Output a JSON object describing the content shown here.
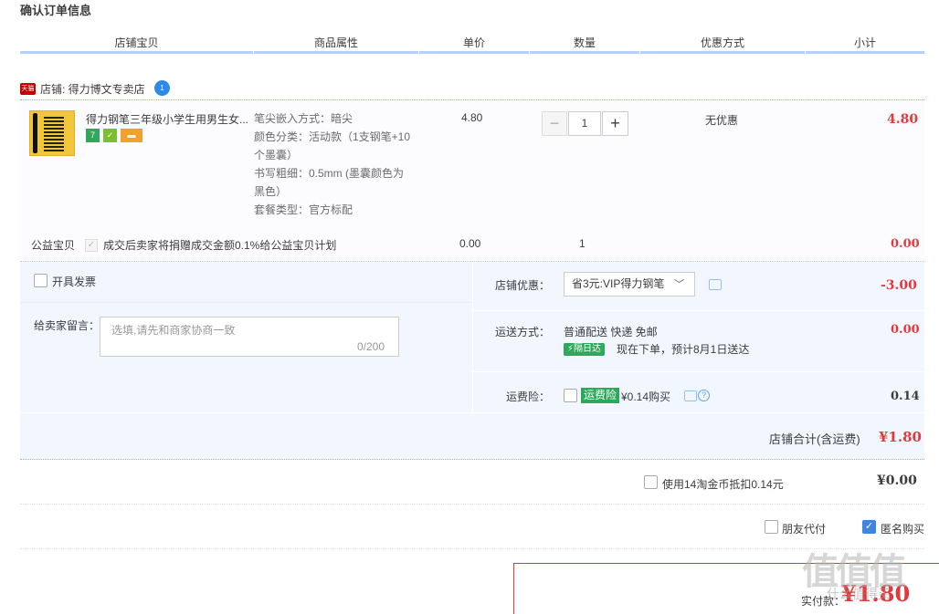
{
  "page": {
    "title": "确认订单信息"
  },
  "columns": [
    "店铺宝贝",
    "商品属性",
    "单价",
    "数量",
    "优惠方式",
    "小计"
  ],
  "shop": {
    "badge": "天猫",
    "label": "店铺: 得力博文专卖店",
    "ww_icon": "1"
  },
  "item": {
    "name": "得力钢笔三年级小学生用男生女...",
    "service_icons": [
      {
        "text": "7",
        "icon": "seven-day-return-icon",
        "color": "#2ea85a"
      },
      {
        "text": "✓",
        "icon": "quality-guarantee-icon",
        "color": "#7cbf2e"
      },
      {
        "text": "▬",
        "icon": "credit-card-icon",
        "color": "#f2a22c"
      }
    ],
    "attributes": [
      "笔尖嵌入方式：暗尖",
      "颜色分类：活动款（1支钢笔+10",
      "个墨囊）",
      "书写粗细：0.5mm (墨囊颜色为",
      "黑色）",
      "套餐类型：官方标配"
    ],
    "price": "4.80",
    "quantity": "1",
    "qty_minus": "−",
    "qty_plus": "+",
    "discount": "无优惠",
    "subtotal": "4.80"
  },
  "charity": {
    "label": "公益宝贝",
    "check": "✓",
    "text": "成交后卖家将捐赠成交金额0.1%给公益宝贝计划",
    "price": "0.00",
    "quantity": "1",
    "subtotal": "0.00"
  },
  "invoice": {
    "label": "开具发票"
  },
  "message": {
    "label": "给卖家留言：",
    "placeholder": "选填,请先和商家协商一致",
    "counter": "0/200"
  },
  "shop_discount": {
    "label": "店铺优惠：",
    "selected": "省3元:VIP得力钢笔",
    "chevron": "﹀",
    "amount": "-3.00"
  },
  "shipping": {
    "label": "运送方式：",
    "method": "普通配送 快递 免邮",
    "badge": "⚡隔日达",
    "eta": "现在下单，预计8月1日送达",
    "amount": "0.00"
  },
  "insurance": {
    "label": "运费险：",
    "badge": "运费险",
    "price": "¥0.14购买",
    "qmark": "?",
    "amount": "0.14"
  },
  "shop_total": {
    "label": "店铺合计(含运费)",
    "amount": "¥1.80"
  },
  "coins": {
    "label": "使用14淘金币抵扣0.14元",
    "amount": "¥0.00"
  },
  "options": {
    "friend_pay": "朋友代付",
    "anonymous": "匿名购买",
    "anon_check": "✓"
  },
  "payment": {
    "label": "实付款：",
    "amount": "¥1.80"
  },
  "watermark": {
    "text": "值值值",
    "sub": "什么值得买"
  }
}
